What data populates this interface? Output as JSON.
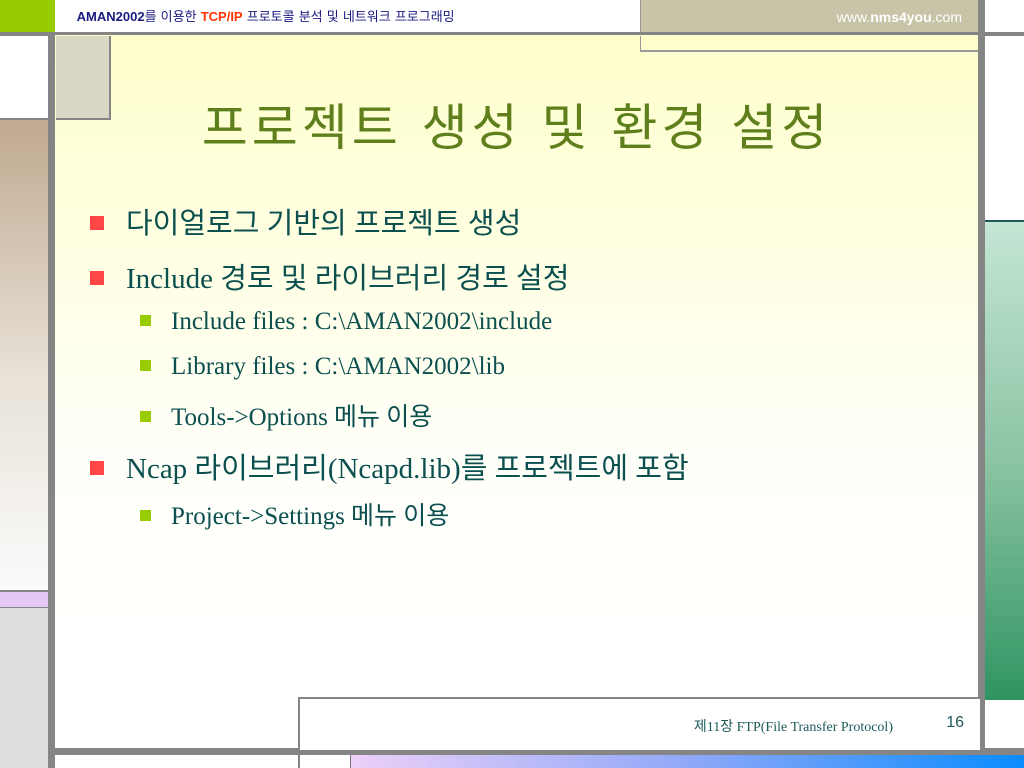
{
  "header": {
    "brand": "AMAN2002",
    "text1": "를 이용한 ",
    "tcpip": "TCP/IP",
    "text2": " 프로토콜 분석 및 네트워크 프로그래밍",
    "url_prefix": "www.",
    "url_bold": "nms4you",
    "url_suffix": ".com"
  },
  "slide": {
    "title": "프로젝트 생성 및 환경 설정",
    "bullets": [
      {
        "level": 1,
        "text": "다이얼로그 기반의 프로젝트 생성"
      },
      {
        "level": 1,
        "text": "Include 경로 및 라이브러리 경로 설정"
      },
      {
        "level": 2,
        "text": "Include files : C:\\AMAN2002\\include"
      },
      {
        "level": 2,
        "text": "Library files : C:\\AMAN2002\\lib"
      },
      {
        "level": 2,
        "text": "Tools->Options 메뉴 이용"
      },
      {
        "level": 1,
        "text": "Ncap 라이브러리(Ncapd.lib)를 프로젝트에 포함"
      },
      {
        "level": 2,
        "text": "Project->Settings 메뉴 이용"
      }
    ]
  },
  "footer": {
    "chapter": "제11장 FTP(File Transfer Protocol)",
    "page": "16"
  }
}
